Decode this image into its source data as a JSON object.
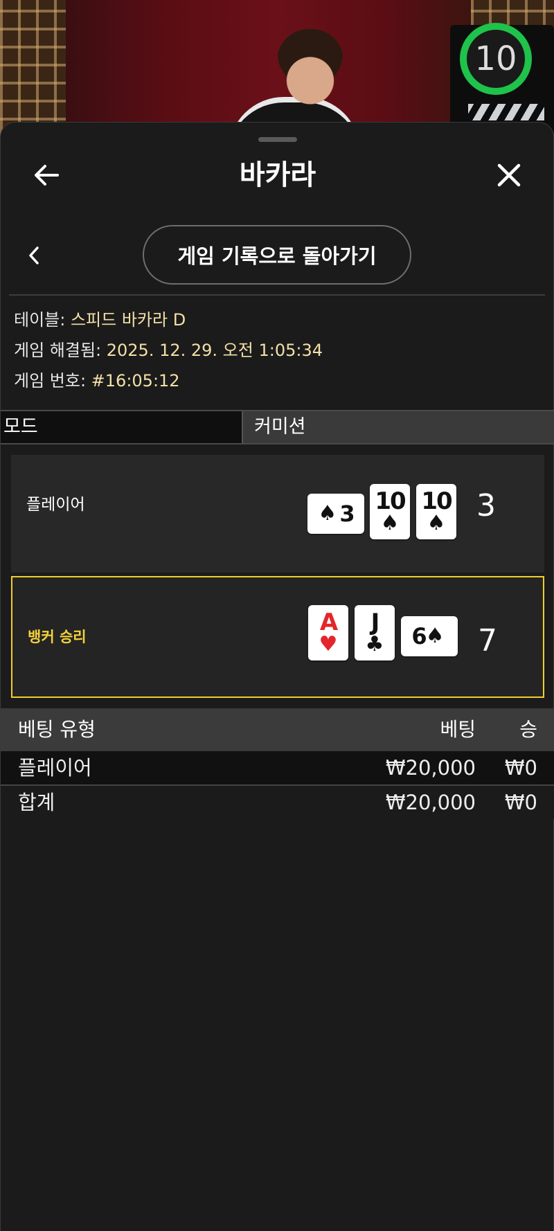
{
  "live": {
    "timer": "10",
    "colors": {
      "timer_ring": "#1fc24a",
      "curtain": "#6a1018"
    }
  },
  "header": {
    "title": "바카라",
    "back_icon": "arrow-left-icon",
    "close_icon": "close-icon"
  },
  "subnav": {
    "back_icon": "chevron-left-icon",
    "history_button": "게임 기록으로 돌아가기"
  },
  "info": {
    "table_label": "테이블: ",
    "table_value": "스피드 바카라 D",
    "resolved_label": "게임 해결됨: ",
    "resolved_value": "2025. 12. 29. 오전 1:05:34",
    "number_label": "게임 번호: ",
    "number_value": "#16:05:12"
  },
  "mode_bar": {
    "mode": "모드",
    "commission": "커미션"
  },
  "hands": {
    "player": {
      "label": "플레이어",
      "score": "3",
      "cards": [
        {
          "rank": "3",
          "suit": "♠",
          "orientation": "horizontal",
          "color": "black"
        },
        {
          "rank": "10",
          "suit": "♠",
          "orientation": "vertical",
          "color": "black"
        },
        {
          "rank": "10",
          "suit": "♠",
          "orientation": "vertical",
          "color": "black"
        }
      ]
    },
    "banker": {
      "label": "뱅커 승리",
      "score": "7",
      "cards": [
        {
          "rank": "A",
          "suit": "♥",
          "orientation": "vertical",
          "color": "red"
        },
        {
          "rank": "J",
          "suit": "♣",
          "orientation": "vertical",
          "color": "black"
        },
        {
          "rank": "6",
          "suit": "♠",
          "orientation": "horizontal",
          "color": "black"
        }
      ]
    },
    "colors": {
      "winner_border": "#f1cf2b"
    }
  },
  "bet_table": {
    "headers": {
      "type": "베팅 유형",
      "bet": "베팅",
      "win": "승"
    },
    "rows": [
      {
        "type": "플레이어",
        "bet": "₩20,000",
        "win": "₩0"
      }
    ],
    "total": {
      "type": "합계",
      "bet": "₩20,000",
      "win": "₩0"
    }
  }
}
